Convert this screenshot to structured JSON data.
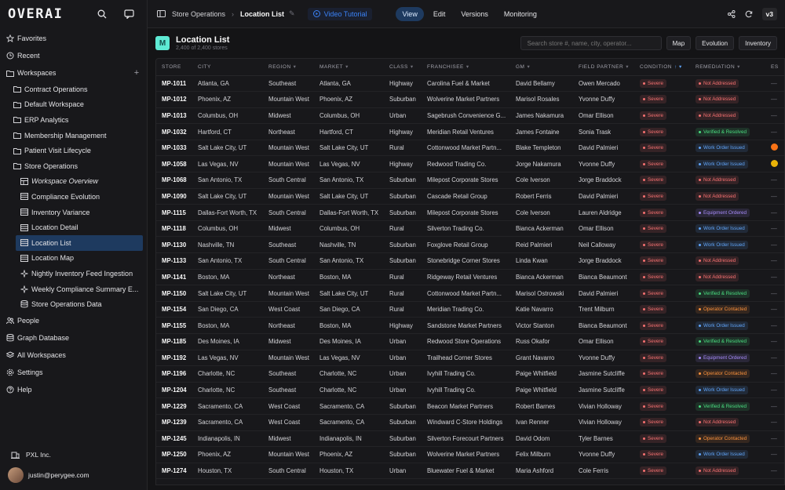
{
  "brand": {
    "logo": "OVERAI"
  },
  "sidebar": {
    "top": [
      {
        "label": "Favorites",
        "icon": "star-icon"
      },
      {
        "label": "Recent",
        "icon": "clock-icon"
      },
      {
        "label": "Workspaces",
        "icon": "folder-icon"
      }
    ],
    "workspaces": [
      "Contract Operations",
      "Default Workspace",
      "ERP Analytics",
      "Membership Management",
      "Patient Visit Lifecycle",
      "Store Operations"
    ],
    "store_ops": [
      {
        "label": "Workspace Overview",
        "icon": "grid-icon"
      },
      {
        "label": "Compliance Evolution",
        "icon": "table-icon"
      },
      {
        "label": "Inventory Variance",
        "icon": "table-icon"
      },
      {
        "label": "Location Detail",
        "icon": "table-icon"
      },
      {
        "label": "Location List",
        "icon": "table-icon"
      },
      {
        "label": "Location Map",
        "icon": "table-icon"
      },
      {
        "label": "Nightly Inventory Feed Ingestion",
        "icon": "sparkle-icon"
      },
      {
        "label": "Weekly Compliance Summary E...",
        "icon": "sparkle-icon"
      },
      {
        "label": "Store Operations Data",
        "icon": "database-icon"
      }
    ],
    "bottom_nav": [
      {
        "label": "People",
        "icon": "people-icon"
      },
      {
        "label": "Graph Database",
        "icon": "database-icon"
      },
      {
        "label": "All Workspaces",
        "icon": "stack-icon"
      },
      {
        "label": "Settings",
        "icon": "gear-icon"
      },
      {
        "label": "Help",
        "icon": "help-icon"
      }
    ],
    "org": "PXL Inc.",
    "user": "justin@perygee.com"
  },
  "topbar": {
    "breadcrumb": [
      "Store Operations",
      "Location List"
    ],
    "video": "Video Tutorial",
    "tabs": [
      "View",
      "Edit",
      "Versions",
      "Monitoring"
    ],
    "active_tab": "View",
    "version": "v3"
  },
  "header": {
    "badge": "M",
    "title": "Location List",
    "subtitle": "2,400 of 2,400 stores",
    "search_placeholder": "Search store #, name, city, operator...",
    "buttons": [
      "Map",
      "Evolution",
      "Inventory"
    ]
  },
  "table": {
    "columns": [
      "STORE",
      "CITY",
      "REGION",
      "MARKET",
      "CLASS",
      "FRANCHISEE",
      "GM",
      "FIELD PARTNER",
      "CONDITION",
      "REMEDIATION",
      "ES"
    ],
    "colors": {
      "Not Addressed": "#f87171",
      "Verified & Resolved": "#4ade80",
      "Work Order Issued": "#60a5fa",
      "Equipment Ordered": "#a78bfa",
      "Operator Contacted": "#fb923c",
      "Severe": "#f87171"
    },
    "rows": [
      [
        "MP-1011",
        "Atlanta, GA",
        "Southeast",
        "Atlanta, GA",
        "Highway",
        "Carolina Fuel & Market",
        "David Bellamy",
        "Owen Mercado",
        "Severe",
        "Not Addressed",
        ""
      ],
      [
        "MP-1012",
        "Phoenix, AZ",
        "Mountain West",
        "Phoenix, AZ",
        "Suburban",
        "Wolverine Market Partners",
        "Marisol Rosales",
        "Yvonne Duffy",
        "Severe",
        "Not Addressed",
        ""
      ],
      [
        "MP-1013",
        "Columbus, OH",
        "Midwest",
        "Columbus, OH",
        "Urban",
        "Sagebrush Convenience G...",
        "James Nakamura",
        "Omar Ellison",
        "Severe",
        "Not Addressed",
        ""
      ],
      [
        "MP-1032",
        "Hartford, CT",
        "Northeast",
        "Hartford, CT",
        "Highway",
        "Meridian Retail Ventures",
        "James Fontaine",
        "Sonia Trask",
        "Severe",
        "Verified & Resolved",
        ""
      ],
      [
        "MP-1033",
        "Salt Lake City, UT",
        "Mountain West",
        "Salt Lake City, UT",
        "Rural",
        "Cottonwood Market Partn...",
        "Blake Templeton",
        "David Palmieri",
        "Severe",
        "Work Order Issued",
        "orange"
      ],
      [
        "MP-1058",
        "Las Vegas, NV",
        "Mountain West",
        "Las Vegas, NV",
        "Highway",
        "Redwood Trading Co.",
        "Jorge Nakamura",
        "Yvonne Duffy",
        "Severe",
        "Work Order Issued",
        "yellow"
      ],
      [
        "MP-1068",
        "San Antonio, TX",
        "South Central",
        "San Antonio, TX",
        "Suburban",
        "Milepost Corporate Stores",
        "Cole Iverson",
        "Jorge Braddock",
        "Severe",
        "Not Addressed",
        ""
      ],
      [
        "MP-1090",
        "Salt Lake City, UT",
        "Mountain West",
        "Salt Lake City, UT",
        "Suburban",
        "Cascade Retail Group",
        "Robert Ferris",
        "David Palmieri",
        "Severe",
        "Not Addressed",
        ""
      ],
      [
        "MP-1115",
        "Dallas-Fort Worth, TX",
        "South Central",
        "Dallas-Fort Worth, TX",
        "Suburban",
        "Milepost Corporate Stores",
        "Cole Iverson",
        "Lauren Aldridge",
        "Severe",
        "Equipment Ordered",
        ""
      ],
      [
        "MP-1118",
        "Columbus, OH",
        "Midwest",
        "Columbus, OH",
        "Rural",
        "Silverton Trading Co.",
        "Bianca Ackerman",
        "Omar Ellison",
        "Severe",
        "Work Order Issued",
        ""
      ],
      [
        "MP-1130",
        "Nashville, TN",
        "Southeast",
        "Nashville, TN",
        "Suburban",
        "Foxglove Retail Group",
        "Reid Palmieri",
        "Neil Calloway",
        "Severe",
        "Work Order Issued",
        ""
      ],
      [
        "MP-1133",
        "San Antonio, TX",
        "South Central",
        "San Antonio, TX",
        "Suburban",
        "Stonebridge Corner Stores",
        "Linda Kwan",
        "Jorge Braddock",
        "Severe",
        "Not Addressed",
        ""
      ],
      [
        "MP-1141",
        "Boston, MA",
        "Northeast",
        "Boston, MA",
        "Rural",
        "Ridgeway Retail Ventures",
        "Bianca Ackerman",
        "Bianca Beaumont",
        "Severe",
        "Not Addressed",
        ""
      ],
      [
        "MP-1150",
        "Salt Lake City, UT",
        "Mountain West",
        "Salt Lake City, UT",
        "Rural",
        "Cottonwood Market Partn...",
        "Marisol Ostrowski",
        "David Palmieri",
        "Severe",
        "Verified & Resolved",
        ""
      ],
      [
        "MP-1154",
        "San Diego, CA",
        "West Coast",
        "San Diego, CA",
        "Rural",
        "Meridian Trading Co.",
        "Katie Navarro",
        "Trent Milburn",
        "Severe",
        "Operator Contacted",
        ""
      ],
      [
        "MP-1155",
        "Boston, MA",
        "Northeast",
        "Boston, MA",
        "Highway",
        "Sandstone Market Partners",
        "Victor Stanton",
        "Bianca Beaumont",
        "Severe",
        "Work Order Issued",
        ""
      ],
      [
        "MP-1185",
        "Des Moines, IA",
        "Midwest",
        "Des Moines, IA",
        "Urban",
        "Redwood Store Operations",
        "Russ Okafor",
        "Omar Ellison",
        "Severe",
        "Verified & Resolved",
        ""
      ],
      [
        "MP-1192",
        "Las Vegas, NV",
        "Mountain West",
        "Las Vegas, NV",
        "Urban",
        "Trailhead Corner Stores",
        "Grant Navarro",
        "Yvonne Duffy",
        "Severe",
        "Equipment Ordered",
        ""
      ],
      [
        "MP-1196",
        "Charlotte, NC",
        "Southeast",
        "Charlotte, NC",
        "Urban",
        "Ivyhill Trading Co.",
        "Paige Whitfield",
        "Jasmine Sutcliffe",
        "Severe",
        "Operator Contacted",
        ""
      ],
      [
        "MP-1204",
        "Charlotte, NC",
        "Southeast",
        "Charlotte, NC",
        "Urban",
        "Ivyhill Trading Co.",
        "Paige Whitfield",
        "Jasmine Sutcliffe",
        "Severe",
        "Work Order Issued",
        ""
      ],
      [
        "MP-1229",
        "Sacramento, CA",
        "West Coast",
        "Sacramento, CA",
        "Suburban",
        "Beacon Market Partners",
        "Robert Barnes",
        "Vivian Holloway",
        "Severe",
        "Verified & Resolved",
        ""
      ],
      [
        "MP-1239",
        "Sacramento, CA",
        "West Coast",
        "Sacramento, CA",
        "Suburban",
        "Windward C-Store Holdings",
        "Ivan Renner",
        "Vivian Holloway",
        "Severe",
        "Not Addressed",
        ""
      ],
      [
        "MP-1245",
        "Indianapolis, IN",
        "Midwest",
        "Indianapolis, IN",
        "Suburban",
        "Silverton Forecourt Partners",
        "David Odom",
        "Tyler Barnes",
        "Severe",
        "Operator Contacted",
        ""
      ],
      [
        "MP-1250",
        "Phoenix, AZ",
        "Mountain West",
        "Phoenix, AZ",
        "Suburban",
        "Wolverine Market Partners",
        "Felix Milburn",
        "Yvonne Duffy",
        "Severe",
        "Work Order Issued",
        ""
      ],
      [
        "MP-1274",
        "Houston, TX",
        "South Central",
        "Houston, TX",
        "Urban",
        "Bluewater Fuel & Market",
        "Maria Ashford",
        "Cole Ferris",
        "Severe",
        "Not Addressed",
        ""
      ]
    ]
  }
}
